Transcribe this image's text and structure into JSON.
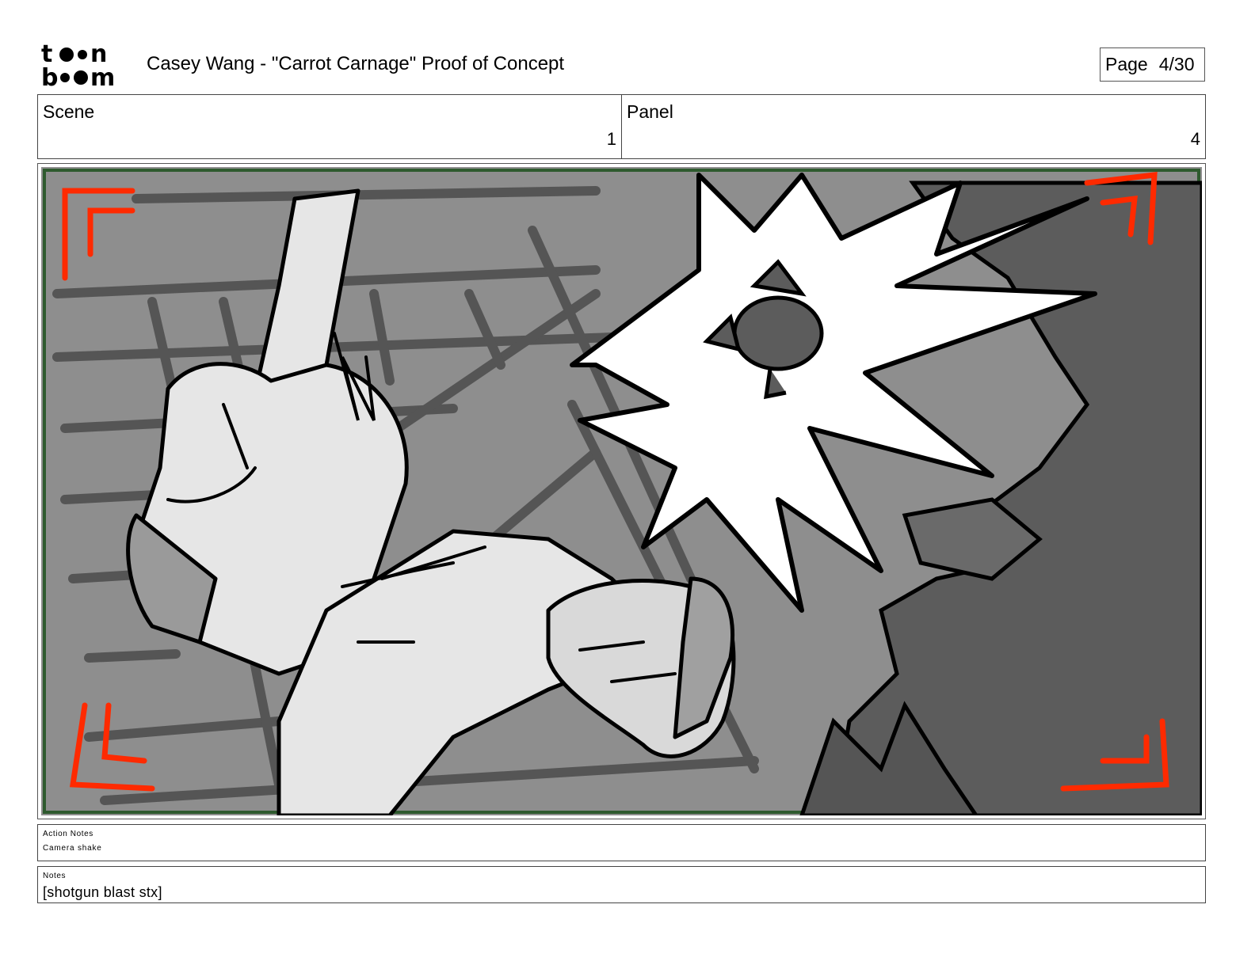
{
  "header": {
    "logo_text": "toon boom",
    "title": "Casey Wang - \"Carrot Carnage\" Proof of Concept",
    "page_label": "Page",
    "page_value": "4/30"
  },
  "meta": {
    "scene_label": "Scene",
    "scene_value": "1",
    "panel_label": "Panel",
    "panel_value": "4"
  },
  "artwork": {
    "description_icon": "storyboard-sketch",
    "frame_border_color": "#2e5a2e",
    "safe_area_marker_color": "#ff2a00"
  },
  "notes": {
    "action_label": "Action Notes",
    "action_text": "Camera shake",
    "notes_label": "Notes",
    "notes_text": "[shotgun blast stx]"
  }
}
